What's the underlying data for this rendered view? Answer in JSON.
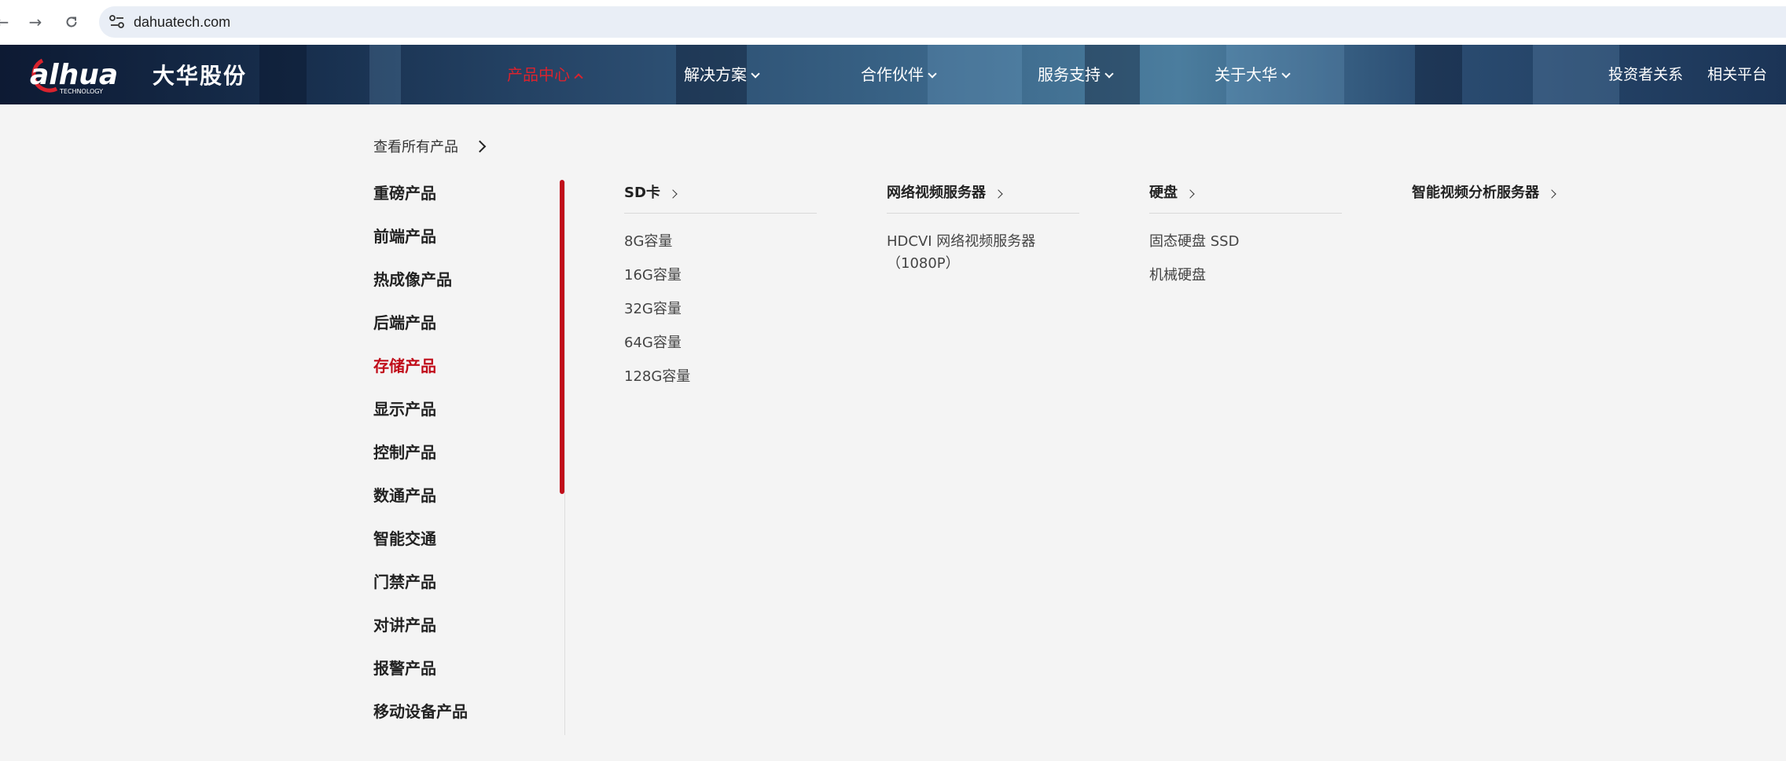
{
  "browser": {
    "back_icon": "arrow-left-icon",
    "forward_icon": "arrow-right-icon",
    "reload_icon": "reload-icon",
    "site_info_icon": "site-settings-icon",
    "url": "dahuatech.com"
  },
  "header": {
    "logo_text": "alhua",
    "logo_sub": "TECHNOLOGY",
    "logo_cn": "大华股份",
    "nav": [
      {
        "label": "产品中心",
        "active": true
      },
      {
        "label": "解决方案",
        "active": false
      },
      {
        "label": "合作伙伴",
        "active": false
      },
      {
        "label": "服务支持",
        "active": false
      },
      {
        "label": "关于大华",
        "active": false
      }
    ],
    "right": [
      "投资者关系",
      "相关平台"
    ],
    "accent_color": "#d9232e"
  },
  "dropdown": {
    "view_all": "查看所有产品",
    "categories": [
      "重磅产品",
      "前端产品",
      "热成像产品",
      "后端产品",
      "存储产品",
      "显示产品",
      "控制产品",
      "数通产品",
      "智能交通",
      "门禁产品",
      "对讲产品",
      "报警产品",
      "移动设备产品"
    ],
    "active_category": "存储产品",
    "active_color": "#c00d1a",
    "columns": [
      {
        "title": "SD卡",
        "items": [
          "8G容量",
          "16G容量",
          "32G容量",
          "64G容量",
          "128G容量"
        ]
      },
      {
        "title": "网络视频服务器",
        "items": [
          "HDCVI 网络视频服务器（1080P）"
        ]
      },
      {
        "title": "硬盘",
        "items": [
          "固态硬盘 SSD",
          "机械硬盘"
        ]
      },
      {
        "title": "智能视频分析服务器",
        "items": []
      }
    ]
  }
}
